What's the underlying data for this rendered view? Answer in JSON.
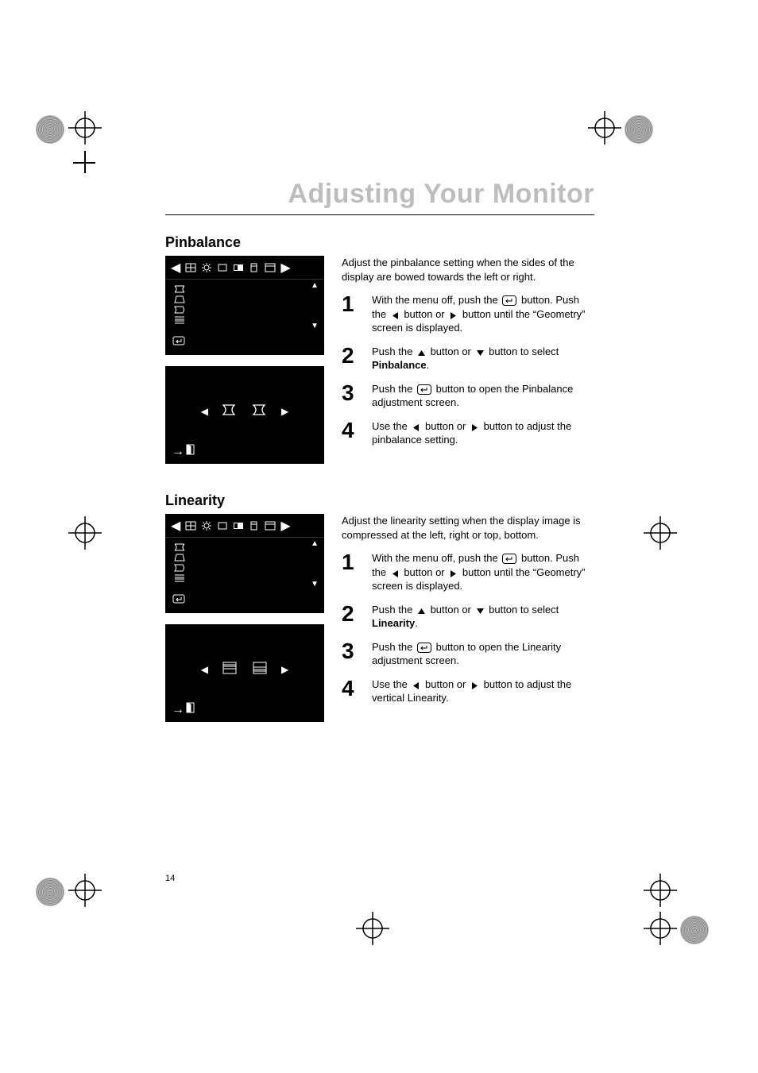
{
  "page": {
    "title": "Adjusting Your Monitor",
    "number": "14"
  },
  "icons": {
    "enter": "enter-icon",
    "left": "triangle-left-icon",
    "right": "triangle-right-icon",
    "up": "triangle-up-icon",
    "down": "triangle-down-icon"
  },
  "sections": [
    {
      "heading": "Pinbalance",
      "intro": "Adjust the pinbalance setting when the sides of the display are bowed towards the left or right.",
      "steps": [
        {
          "n": "1",
          "pre1": "With the menu off, push the ",
          "mid1": " button. Push the ",
          "mid2": " button or ",
          "post": " button until the “Geometry” screen is displayed."
        },
        {
          "n": "2",
          "pre1": "Push the ",
          "mid2": " button or ",
          "post": " button to select ",
          "bold": "Pinbalance",
          "tail": "."
        },
        {
          "n": "3",
          "pre1": "Push the ",
          "post": " button to open the Pinbalance adjustment screen."
        },
        {
          "n": "4",
          "pre1": "Use the ",
          "mid2": " button or ",
          "post": " button to adjust the pinbalance setting."
        }
      ],
      "adjust_left_icon": "pinbalance-left-icon",
      "adjust_right_icon": "pinbalance-right-icon"
    },
    {
      "heading": "Linearity",
      "intro": "Adjust the linearity setting when the display image is compressed at the left, right or top, bottom.",
      "steps": [
        {
          "n": "1",
          "pre1": "With the menu off, push the ",
          "mid1": " button. Push the ",
          "mid2": " button or ",
          "post": " button until the “Geometry” screen is displayed."
        },
        {
          "n": "2",
          "pre1": "Push the ",
          "mid2": " button or ",
          "post": " button to select ",
          "bold": "Linearity",
          "tail": "."
        },
        {
          "n": "3",
          "pre1": "Push the ",
          "post": " button to open the Linearity adjustment screen."
        },
        {
          "n": "4",
          "pre1": "Use the ",
          "mid2": " button or ",
          "post": " button to adjust the vertical Linearity."
        }
      ],
      "adjust_left_icon": "linearity-left-icon",
      "adjust_right_icon": "linearity-right-icon"
    }
  ]
}
